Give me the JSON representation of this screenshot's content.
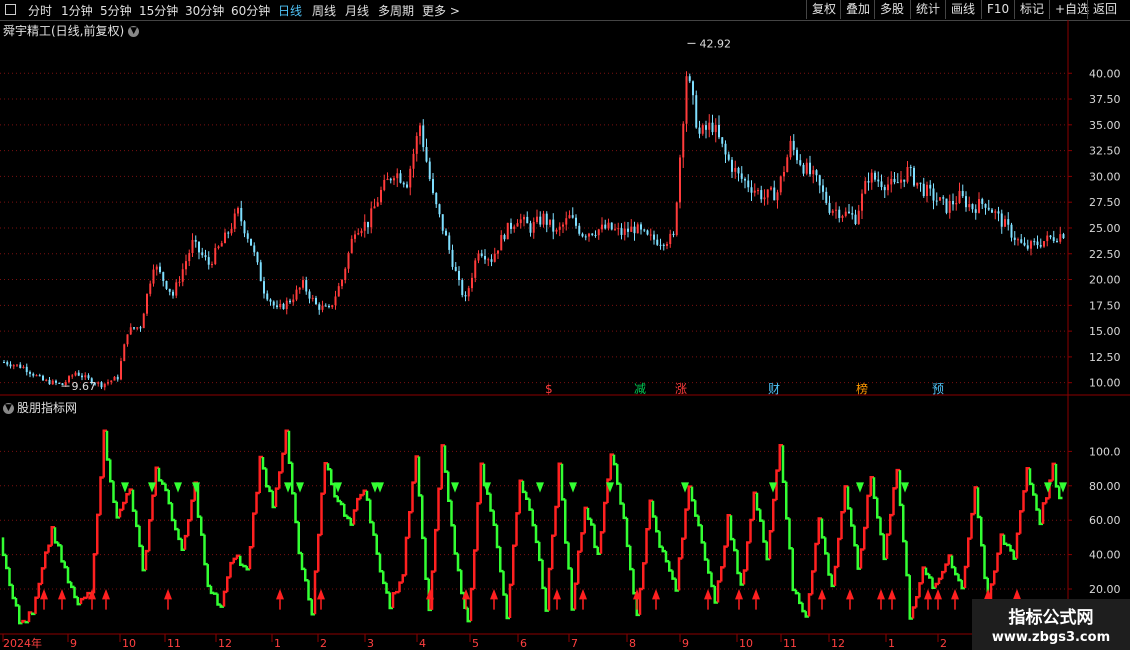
{
  "toolbar": {
    "periods": [
      "分时",
      "1分钟",
      "5分钟",
      "15分钟",
      "30分钟",
      "60分钟",
      "日线",
      "周线",
      "月线",
      "多周期",
      "更多 >"
    ],
    "active_period": "日线",
    "right_buttons": [
      "复权",
      "叠加",
      "多股",
      "统计",
      "画线",
      "F10",
      "标记",
      "+自选",
      "返回"
    ]
  },
  "main_chart": {
    "title": "舜宇精工(日线,前复权)",
    "high_label": "42.92",
    "low_label": "9.67",
    "y_ticks": [
      "40.00",
      "37.50",
      "35.00",
      "32.50",
      "30.00",
      "27.50",
      "25.00",
      "22.50",
      "20.00",
      "17.50",
      "15.00",
      "12.50",
      "10.00"
    ],
    "event_markers": [
      {
        "label": "$",
        "color": "#ff3b3b"
      },
      {
        "label": "减",
        "color": "#00c853"
      },
      {
        "label": "涨",
        "color": "#ff3b3b"
      },
      {
        "label": "财",
        "color": "#4fc3f7"
      },
      {
        "label": "榜",
        "color": "#ff9800"
      },
      {
        "label": "预",
        "color": "#4fc3f7"
      }
    ]
  },
  "indicator": {
    "title": "股朋指标网",
    "y_ticks": [
      "100.0",
      "80.00",
      "60.00",
      "40.00",
      "20.00"
    ]
  },
  "x_axis": {
    "labels": [
      "2024年",
      "9",
      "10",
      "11",
      "12",
      "1",
      "2",
      "3",
      "4",
      "5",
      "6",
      "7",
      "8",
      "9",
      "10",
      "11",
      "12",
      "1",
      "2"
    ]
  },
  "watermark": {
    "line1": "指标公式网",
    "line2": "www.zbgs3.com"
  },
  "colors": {
    "up": "#ff3b3b",
    "down": "#7fdfff",
    "ind_up": "#ff2020",
    "ind_down": "#33ff33",
    "grid": "#7a1010",
    "axis": "#8b0000",
    "active_tab": "#4fc3f7"
  },
  "chart_data": [
    {
      "type": "candlestick",
      "title": "舜宇精工(日线,前复权)",
      "ylim": [
        9,
        44
      ],
      "ticks": [
        40.0,
        37.5,
        35.0,
        32.5,
        30.0,
        27.5,
        25.0,
        22.5,
        20.0,
        17.5,
        15.0,
        12.5,
        10.0
      ],
      "profile": [
        [
          0,
          12.0
        ],
        [
          6,
          11.5
        ],
        [
          12,
          10.2
        ],
        [
          18,
          9.8
        ],
        [
          22,
          11.0
        ],
        [
          26,
          10.3
        ],
        [
          30,
          9.8
        ],
        [
          35,
          10.5
        ],
        [
          38,
          15.0
        ],
        [
          42,
          15.5
        ],
        [
          46,
          21.5
        ],
        [
          52,
          18.5
        ],
        [
          58,
          23.5
        ],
        [
          63,
          21.5
        ],
        [
          68,
          24.0
        ],
        [
          72,
          26.5
        ],
        [
          76,
          23.5
        ],
        [
          80,
          19.0
        ],
        [
          84,
          17.0
        ],
        [
          88,
          18.0
        ],
        [
          92,
          19.5
        ],
        [
          96,
          17.5
        ],
        [
          100,
          17.0
        ],
        [
          104,
          20.0
        ],
        [
          108,
          25.0
        ],
        [
          112,
          25.5
        ],
        [
          116,
          28.5
        ],
        [
          120,
          30.5
        ],
        [
          124,
          29.5
        ],
        [
          128,
          35.0
        ],
        [
          132,
          28.0
        ],
        [
          136,
          24.0
        ],
        [
          140,
          19.5
        ],
        [
          142,
          18.0
        ],
        [
          146,
          23.0
        ],
        [
          150,
          22.0
        ],
        [
          154,
          24.5
        ],
        [
          158,
          26.0
        ],
        [
          162,
          25.0
        ],
        [
          166,
          26.0
        ],
        [
          170,
          24.5
        ],
        [
          174,
          26.0
        ],
        [
          178,
          24.5
        ],
        [
          182,
          24.8
        ],
        [
          186,
          25.0
        ],
        [
          190,
          24.5
        ],
        [
          194,
          25.0
        ],
        [
          198,
          24.0
        ],
        [
          202,
          23.8
        ],
        [
          206,
          24.0
        ],
        [
          210,
          40.0
        ],
        [
          214,
          34.0
        ],
        [
          218,
          35.0
        ],
        [
          222,
          32.0
        ],
        [
          226,
          30.0
        ],
        [
          230,
          29.0
        ],
        [
          234,
          28.0
        ],
        [
          238,
          28.5
        ],
        [
          242,
          33.0
        ],
        [
          246,
          31.0
        ],
        [
          250,
          29.5
        ],
        [
          254,
          27.0
        ],
        [
          258,
          26.5
        ],
        [
          262,
          26.0
        ],
        [
          266,
          30.0
        ],
        [
          270,
          29.5
        ],
        [
          274,
          29.0
        ],
        [
          278,
          30.5
        ],
        [
          282,
          29.0
        ],
        [
          286,
          28.0
        ],
        [
          290,
          27.0
        ],
        [
          294,
          28.0
        ],
        [
          298,
          27.0
        ],
        [
          302,
          27.5
        ],
        [
          306,
          26.0
        ],
        [
          310,
          24.5
        ],
        [
          314,
          23.0
        ],
        [
          318,
          23.5
        ],
        [
          322,
          24.0
        ],
        [
          326,
          24.5
        ]
      ]
    },
    {
      "type": "line",
      "title": "股朋指标网",
      "ylim": [
        -5,
        120
      ],
      "ticks": [
        100,
        80,
        60,
        40,
        20
      ],
      "profile": [
        [
          0,
          50
        ],
        [
          6,
          0
        ],
        [
          10,
          5
        ],
        [
          16,
          55
        ],
        [
          20,
          30
        ],
        [
          24,
          10
        ],
        [
          28,
          20
        ],
        [
          32,
          110
        ],
        [
          36,
          60
        ],
        [
          40,
          80
        ],
        [
          44,
          30
        ],
        [
          48,
          90
        ],
        [
          52,
          70
        ],
        [
          56,
          40
        ],
        [
          60,
          80
        ],
        [
          64,
          20
        ],
        [
          68,
          10
        ],
        [
          72,
          40
        ],
        [
          76,
          30
        ],
        [
          80,
          95
        ],
        [
          84,
          70
        ],
        [
          88,
          110
        ],
        [
          92,
          40
        ],
        [
          96,
          5
        ],
        [
          100,
          95
        ],
        [
          104,
          70
        ],
        [
          108,
          60
        ],
        [
          112,
          80
        ],
        [
          116,
          40
        ],
        [
          120,
          10
        ],
        [
          124,
          30
        ],
        [
          128,
          100
        ],
        [
          132,
          5
        ],
        [
          136,
          105
        ],
        [
          140,
          40
        ],
        [
          144,
          0
        ],
        [
          148,
          90
        ],
        [
          152,
          60
        ],
        [
          156,
          5
        ],
        [
          160,
          80
        ],
        [
          164,
          60
        ],
        [
          168,
          10
        ],
        [
          172,
          90
        ],
        [
          176,
          10
        ],
        [
          180,
          70
        ],
        [
          184,
          40
        ],
        [
          188,
          100
        ],
        [
          192,
          60
        ],
        [
          196,
          5
        ],
        [
          200,
          70
        ],
        [
          204,
          40
        ],
        [
          208,
          20
        ],
        [
          212,
          80
        ],
        [
          216,
          50
        ],
        [
          220,
          10
        ],
        [
          224,
          60
        ],
        [
          228,
          20
        ],
        [
          232,
          75
        ],
        [
          236,
          40
        ],
        [
          240,
          105
        ],
        [
          244,
          20
        ],
        [
          248,
          5
        ],
        [
          252,
          60
        ],
        [
          256,
          20
        ],
        [
          260,
          80
        ],
        [
          264,
          30
        ],
        [
          268,
          85
        ],
        [
          272,
          40
        ],
        [
          276,
          90
        ],
        [
          280,
          5
        ],
        [
          284,
          30
        ],
        [
          288,
          20
        ],
        [
          292,
          40
        ],
        [
          296,
          20
        ],
        [
          300,
          80
        ],
        [
          304,
          10
        ],
        [
          308,
          50
        ],
        [
          312,
          40
        ],
        [
          316,
          90
        ],
        [
          320,
          60
        ],
        [
          324,
          90
        ],
        [
          326,
          70
        ]
      ]
    }
  ]
}
